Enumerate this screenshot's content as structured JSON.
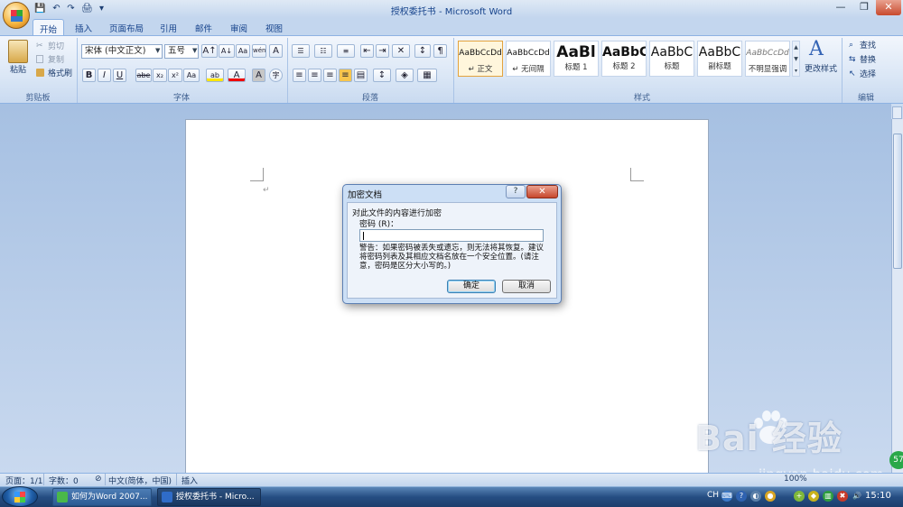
{
  "window": {
    "title": "授权委托书 - Microsoft Word",
    "minimize": "—",
    "restore": "❐",
    "close": "✕"
  },
  "qat": {
    "save": "💾",
    "undo": "↶",
    "redo": "↷",
    "print": "🖨",
    "more": "▾"
  },
  "tabs": [
    "开始",
    "插入",
    "页面布局",
    "引用",
    "邮件",
    "审阅",
    "视图"
  ],
  "ribbon": {
    "clipboard": {
      "paste": "粘贴",
      "cut": "剪切",
      "copy": "复制",
      "format_painter": "格式刷",
      "label": "剪贴板"
    },
    "font": {
      "name": "宋体 (中文正文)",
      "size": "五号",
      "grow": "A↑",
      "shrink": "A↓",
      "clear": "Aa",
      "phonetic": "wén",
      "border_char": "A",
      "bold": "B",
      "italic": "I",
      "underline": "U",
      "strike": "abe",
      "subscript": "x₂",
      "superscript": "x²",
      "change_case": "Aa",
      "highlight": "ab",
      "font_color": "A",
      "char_shading": "A",
      "enclose": "字",
      "label": "字体"
    },
    "paragraph": {
      "label": "段落"
    },
    "styles": {
      "items": [
        {
          "sample": "AaBbCcDd",
          "name": "↵ 正文"
        },
        {
          "sample": "AaBbCcDd",
          "name": "↵ 无间隔"
        },
        {
          "sample": "AaBl",
          "name": "标题 1"
        },
        {
          "sample": "AaBbC",
          "name": "标题 2"
        },
        {
          "sample": "AaBbC",
          "name": "标题"
        },
        {
          "sample": "AaBbC",
          "name": "副标题"
        },
        {
          "sample": "AaBbCcDd",
          "name": "不明显强调"
        }
      ],
      "change_styles": "更改样式",
      "label": "样式"
    },
    "editing": {
      "find": "查找",
      "replace": "替换",
      "select": "选择",
      "label": "编辑"
    }
  },
  "document": {
    "para_mark": "↵"
  },
  "dialog": {
    "title": "加密文档",
    "help": "?",
    "close": "✕",
    "group": "对此文件的内容进行加密",
    "password_label": "密码 (R)：",
    "password_value": "",
    "warning": "警告：如果密码被丢失或遗忘，则无法将其恢复。建议将密码列表及其相应文档名放在一个安全位置。(请注意，密码是区分大小写的。)",
    "ok": "确定",
    "cancel": "取消"
  },
  "status": {
    "page": "页面：1/1",
    "words": "字数：0",
    "language": "中文(简体，中国)",
    "mode": "插入",
    "zoom": "100%"
  },
  "taskbar": {
    "tasks": [
      {
        "label": "如何为Word 2007...",
        "color": "#4ab84a"
      },
      {
        "label": "授权委托书 - Micro...",
        "color": "#2f6cc8"
      }
    ],
    "lang": "CH",
    "time": "15:10"
  },
  "watermark": {
    "text": "Bai 经验",
    "url": "jingyan.baidu.com",
    "badge": "57"
  }
}
